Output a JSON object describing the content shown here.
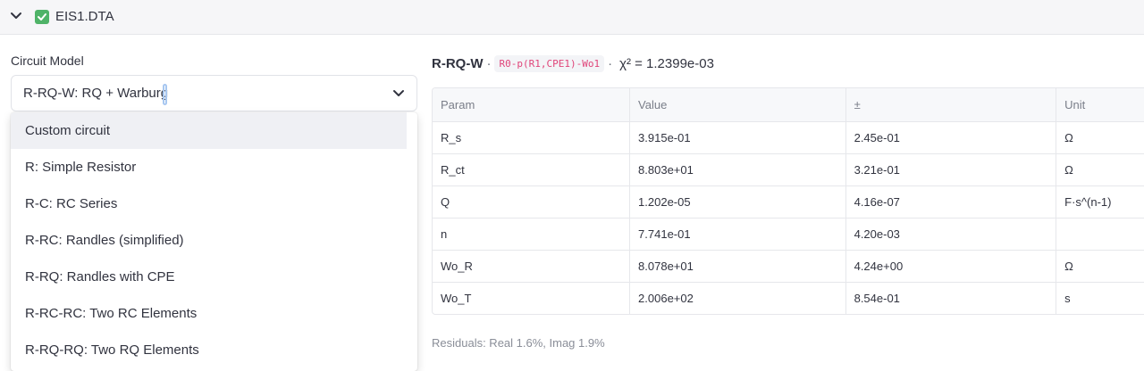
{
  "expander": {
    "title": "EIS1.DTA",
    "icons": {
      "chevron": "chevron-down-icon",
      "check": "check-box-icon"
    },
    "check_color": "#4fb368"
  },
  "circuit_model": {
    "label": "Circuit Model",
    "selected": "R-RQ-W: RQ + Warburg",
    "options": [
      "Custom circuit",
      "R: Simple Resistor",
      "R-C: RC Series",
      "R-RC: Randles (simplified)",
      "R-RQ: Randles with CPE",
      "R-RC-RC: Two RC Elements",
      "R-RQ-RQ: Two RQ Elements"
    ],
    "highlighted_index": 0
  },
  "fit": {
    "model_name": "R-RQ-W",
    "separator": "·",
    "circuit_string": "R0-p(R1,CPE1)-Wo1",
    "chi_squared": "χ² = 1.2399e-03"
  },
  "params_table": {
    "headers": [
      "Param",
      "Value",
      "±",
      "Unit"
    ],
    "rows": [
      [
        "R_s",
        "3.915e-01",
        "2.45e-01",
        "Ω"
      ],
      [
        "R_ct",
        "8.803e+01",
        "3.21e-01",
        "Ω"
      ],
      [
        "Q",
        "1.202e-05",
        "4.16e-07",
        "F·s^(n-1)"
      ],
      [
        "n",
        "7.741e-01",
        "4.20e-03",
        ""
      ],
      [
        "Wo_R",
        "8.078e+01",
        "4.24e+00",
        "Ω"
      ],
      [
        "Wo_T",
        "2.006e+02",
        "8.54e-01",
        "s"
      ]
    ]
  },
  "residuals": "Residuals: Real 1.6%, Imag 1.9%",
  "colors": {
    "accent_code": "#e0457a",
    "focus_caret": "#a7c7f0",
    "header_bg": "#f6f6f8"
  }
}
